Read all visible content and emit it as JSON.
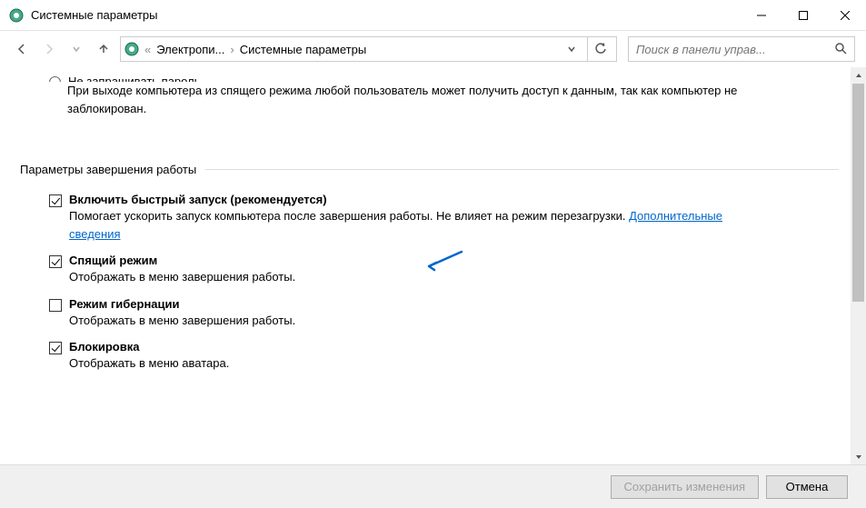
{
  "window": {
    "title": "Системные параметры"
  },
  "breadcrumb": {
    "item1": "Электропи...",
    "item2": "Системные параметры"
  },
  "search": {
    "placeholder": "Поиск в панели управ..."
  },
  "radio_cut": {
    "label": "Не запрашивать пароль",
    "help": "При выходе компьютера из спящего режима любой пользователь может получить доступ к данным, так как компьютер не заблокирован."
  },
  "section": {
    "title": "Параметры завершения работы"
  },
  "options": {
    "fast_startup": {
      "label": "Включить быстрый запуск (рекомендуется)",
      "desc_prefix": "Помогает ускорить запуск компьютера после завершения работы. Не влияет на режим перезагрузки. ",
      "link": "Дополнительные сведения"
    },
    "sleep": {
      "label": "Спящий режим",
      "desc": "Отображать в меню завершения работы."
    },
    "hibernate": {
      "label": "Режим гибернации",
      "desc": "Отображать в меню завершения работы."
    },
    "lock": {
      "label": "Блокировка",
      "desc": "Отображать в меню аватара."
    }
  },
  "buttons": {
    "save": "Сохранить изменения",
    "cancel": "Отмена"
  }
}
